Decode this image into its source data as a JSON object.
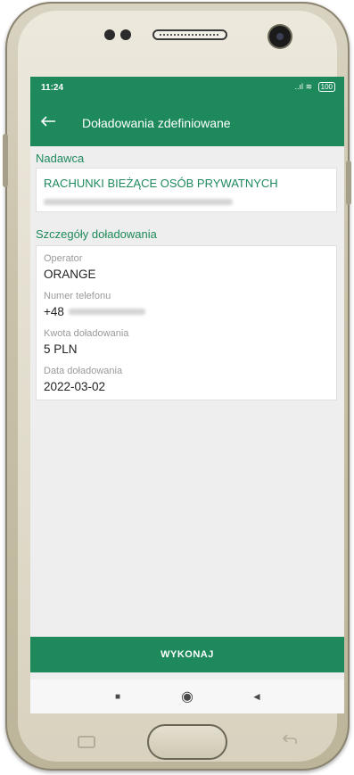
{
  "status_bar": {
    "time": "11:24",
    "signal": "..ıl",
    "wifi": "≋",
    "battery": "100"
  },
  "app_bar": {
    "title": "Doładowania zdefiniowane",
    "back_icon": "arrow-left-icon"
  },
  "sender": {
    "section_label": "Nadawca",
    "account_name": "RACHUNKI BIEŻĄCE OSÓB PRYWATNYCH"
  },
  "details": {
    "section_label": "Szczegóły doładowania",
    "fields": [
      {
        "label": "Operator",
        "value": "ORANGE"
      },
      {
        "label": "Numer telefonu",
        "value": "+48"
      },
      {
        "label": "Kwota doładowania",
        "value": "5 PLN"
      },
      {
        "label": "Data doładowania",
        "value": "2022-03-02"
      }
    ]
  },
  "actions": {
    "execute_label": "WYKONAJ"
  },
  "nav_bar": {
    "recents": "■",
    "home": "◉",
    "back": "◄"
  },
  "colors": {
    "primary": "#1e8a5c",
    "background": "#eeeeee"
  }
}
